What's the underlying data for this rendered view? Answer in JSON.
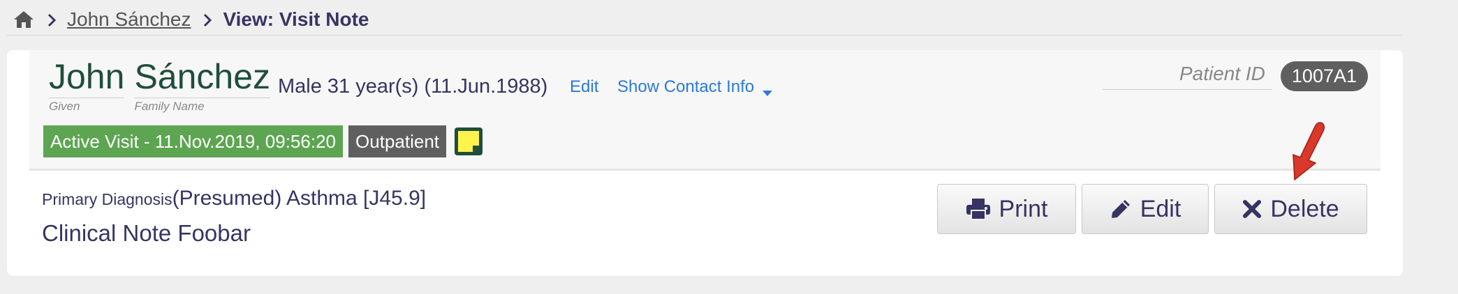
{
  "breadcrumb": {
    "home_icon": "home-icon",
    "patient_link": "John Sánchez ",
    "current": "View: Visit Note"
  },
  "patient": {
    "given_name": "John",
    "given_label": "Given",
    "family_name": "Sánchez",
    "family_label": "Family Name",
    "demographics": "Male  31 year(s) (11.Jun.1988)",
    "edit_label": "Edit",
    "contact_label": "Show Contact Info",
    "patient_id_label": "Patient ID",
    "patient_id": "1007A1"
  },
  "visit": {
    "active_visit": "Active Visit - 11.Nov.2019, 09:56:20",
    "visit_type": "Outpatient",
    "sticky_note_icon": "sticky-note-icon"
  },
  "note": {
    "diagnosis_label": "Primary Diagnosis",
    "diagnosis_value": "(Presumed) Asthma [J45.9]",
    "title": "Clinical Note Foobar"
  },
  "actions": {
    "print": "Print",
    "edit": "Edit",
    "delete": "Delete"
  },
  "colors": {
    "active_visit_bg": "#5da551",
    "badge_dark": "#5f5f5f",
    "link": "#2a7ad6",
    "name_green": "#1f4e3b",
    "sticky_yellow": "#fff34d",
    "arrow_red": "#d9382a"
  }
}
